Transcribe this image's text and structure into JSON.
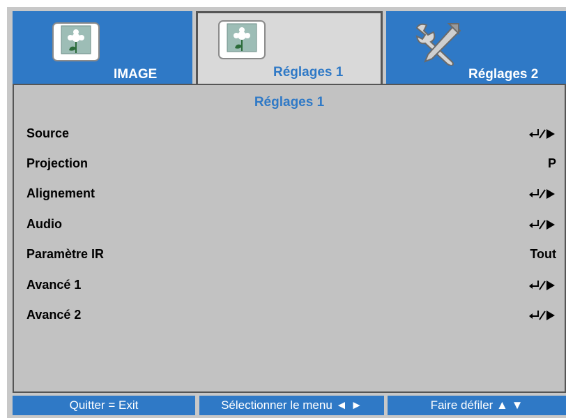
{
  "tabs": [
    {
      "label": "IMAGE",
      "icon": "image-icon",
      "active": false
    },
    {
      "label": "Réglages 1",
      "icon": "image-icon",
      "active": true
    },
    {
      "label": "Réglages 2",
      "icon": "tools-icon",
      "active": false
    }
  ],
  "panel": {
    "title": "Réglages 1",
    "items": [
      {
        "label": "Source",
        "value": null,
        "value_icon": "enter-submenu-icon"
      },
      {
        "label": "Projection",
        "value": "P",
        "value_icon": null
      },
      {
        "label": "Alignement",
        "value": null,
        "value_icon": "enter-submenu-icon"
      },
      {
        "label": "Audio",
        "value": null,
        "value_icon": "enter-submenu-icon"
      },
      {
        "label": "Paramètre IR",
        "value": "Tout",
        "value_icon": null
      },
      {
        "label": "Avancé 1",
        "value": null,
        "value_icon": "enter-submenu-icon"
      },
      {
        "label": "Avancé 2",
        "value": null,
        "value_icon": "enter-submenu-icon"
      }
    ]
  },
  "footer": {
    "exit": "Quitter = Exit",
    "select": "Sélectionner le menu ◄ ►",
    "scroll": "Faire défiler ▲ ▼"
  },
  "colors": {
    "accent": "#2f79c6",
    "panel": "#c2c2c2",
    "frame": "#c8c8c8"
  }
}
